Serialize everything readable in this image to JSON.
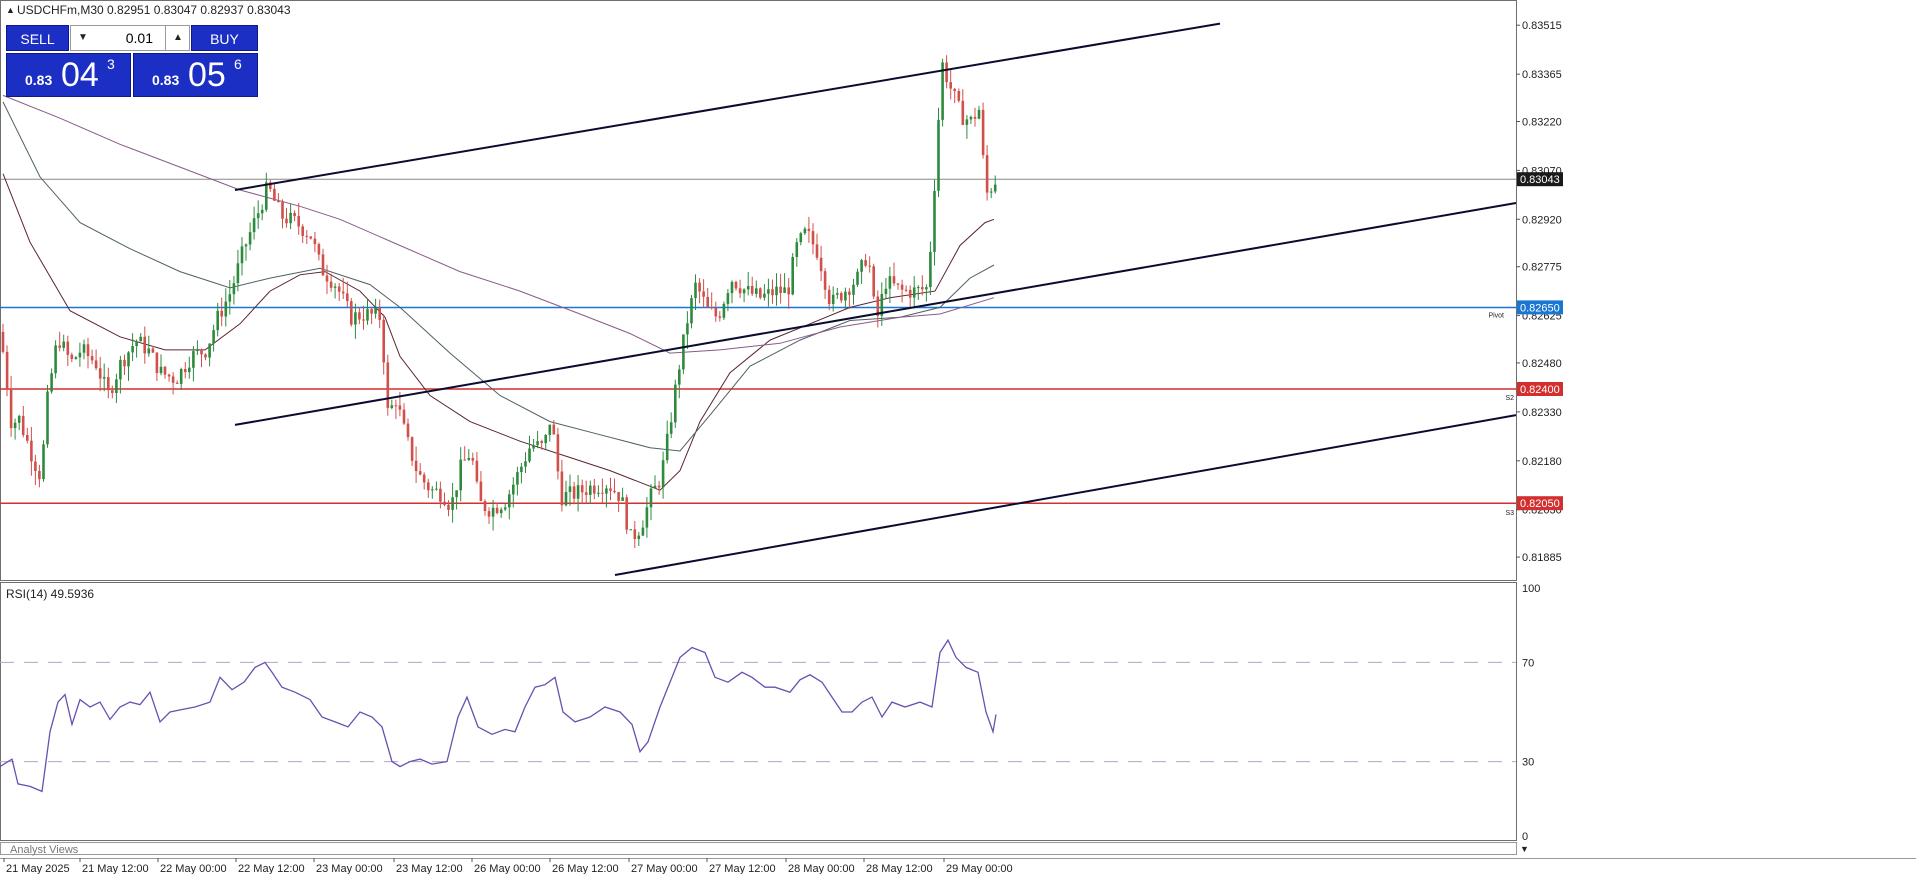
{
  "header": {
    "symbol_line": "USDCHFm,M30  0.82951 0.83047 0.82937 0.83043",
    "collapse_glyph": "▲"
  },
  "trade_panel": {
    "sell_label": "SELL",
    "buy_label": "BUY",
    "volume": "0.01",
    "sell_price": {
      "prefix": "0.83",
      "big": "04",
      "sup": "3"
    },
    "buy_price": {
      "prefix": "0.83",
      "big": "05",
      "sup": "6"
    },
    "down_glyph": "▼",
    "up_glyph": "▲"
  },
  "price_axis": {
    "ticks": [
      "0.83515",
      "0.83365",
      "0.83220",
      "0.83070",
      "0.82920",
      "0.82775",
      "0.82625",
      "0.82480",
      "0.82330",
      "0.82180",
      "0.82030",
      "0.81885"
    ],
    "current_price": "0.83043",
    "pivot_price": "0.82650",
    "s2_price": "0.82400",
    "s3_price": "0.82050"
  },
  "levels": {
    "pivot_label": "Pivot",
    "s2_label": "S2",
    "s3_label": "S3",
    "colors": {
      "pivot": "#1976d2",
      "support": "#d32f2f",
      "current": "#888888"
    }
  },
  "rsi": {
    "title": "RSI(14) 49.5936",
    "ticks": [
      "100",
      "70",
      "30",
      "0"
    ]
  },
  "time_axis": {
    "labels": [
      "21 May 2025",
      "21 May 12:00",
      "22 May 00:00",
      "22 May 12:00",
      "23 May 00:00",
      "23 May 12:00",
      "26 May 00:00",
      "26 May 12:00",
      "27 May 00:00",
      "27 May 12:00",
      "28 May 00:00",
      "28 May 12:00",
      "29 May 00:00"
    ]
  },
  "footer": {
    "analyst_tab": "Analyst Views",
    "scroll_glyph": "▼"
  },
  "colors": {
    "bull": "#2e8b3e",
    "bear": "#d1504b",
    "rsi_line": "#6a4fb0",
    "ma_fast": "#5a2430",
    "ma_mid": "#4f5f66",
    "ma_slow": "#8a5a8a",
    "channel": "#0b0b30",
    "axis_label_bg": "#1a1a1a"
  },
  "chart_data": {
    "type": "candlestick",
    "title": "USDCHFm,M30",
    "ylim": [
      0.8183,
      0.8358
    ],
    "pivot": 0.8265,
    "s2": 0.824,
    "s3": 0.8205,
    "current": 0.83043,
    "price_path": [
      [
        0,
        0.8262
      ],
      [
        8,
        0.825
      ],
      [
        16,
        0.8228
      ],
      [
        22,
        0.8232
      ],
      [
        30,
        0.8225
      ],
      [
        38,
        0.8218
      ],
      [
        45,
        0.8213
      ],
      [
        52,
        0.8238
      ],
      [
        62,
        0.8256
      ],
      [
        75,
        0.8248
      ],
      [
        85,
        0.8252
      ],
      [
        100,
        0.8248
      ],
      [
        112,
        0.8238
      ],
      [
        125,
        0.8248
      ],
      [
        140,
        0.8255
      ],
      [
        152,
        0.8252
      ],
      [
        165,
        0.8245
      ],
      [
        180,
        0.8243
      ],
      [
        195,
        0.825
      ],
      [
        210,
        0.8252
      ],
      [
        222,
        0.8262
      ],
      [
        235,
        0.827
      ],
      [
        248,
        0.8283
      ],
      [
        262,
        0.8294
      ],
      [
        272,
        0.8302
      ],
      [
        285,
        0.8293
      ],
      [
        300,
        0.8291
      ],
      [
        315,
        0.8287
      ],
      [
        325,
        0.8277
      ],
      [
        340,
        0.8272
      ],
      [
        355,
        0.8262
      ],
      [
        370,
        0.8263
      ],
      [
        385,
        0.8262
      ],
      [
        392,
        0.8232
      ],
      [
        400,
        0.8237
      ],
      [
        410,
        0.8225
      ],
      [
        422,
        0.8214
      ],
      [
        435,
        0.8209
      ],
      [
        447,
        0.8208
      ],
      [
        455,
        0.8204
      ],
      [
        465,
        0.8216
      ],
      [
        475,
        0.8221
      ],
      [
        483,
        0.8205
      ],
      [
        495,
        0.8203
      ],
      [
        510,
        0.8206
      ],
      [
        522,
        0.8214
      ],
      [
        535,
        0.8223
      ],
      [
        548,
        0.8222
      ],
      [
        555,
        0.8232
      ],
      [
        565,
        0.8207
      ],
      [
        580,
        0.8208
      ],
      [
        595,
        0.821
      ],
      [
        612,
        0.8211
      ],
      [
        625,
        0.8207
      ],
      [
        635,
        0.8194
      ],
      [
        645,
        0.8198
      ],
      [
        655,
        0.8207
      ],
      [
        665,
        0.8213
      ],
      [
        672,
        0.8225
      ],
      [
        682,
        0.8245
      ],
      [
        692,
        0.8262
      ],
      [
        700,
        0.8272
      ],
      [
        712,
        0.8264
      ],
      [
        722,
        0.8262
      ],
      [
        735,
        0.8274
      ],
      [
        750,
        0.827
      ],
      [
        765,
        0.8268
      ],
      [
        780,
        0.827
      ],
      [
        792,
        0.827
      ],
      [
        800,
        0.8283
      ],
      [
        810,
        0.8288
      ],
      [
        822,
        0.8282
      ],
      [
        835,
        0.8266
      ],
      [
        848,
        0.827
      ],
      [
        862,
        0.8274
      ],
      [
        872,
        0.8282
      ],
      [
        880,
        0.826
      ],
      [
        890,
        0.8273
      ],
      [
        905,
        0.827
      ],
      [
        920,
        0.827
      ],
      [
        932,
        0.8271
      ],
      [
        940,
        0.831
      ],
      [
        946,
        0.834
      ],
      [
        955,
        0.8332
      ],
      [
        965,
        0.8324
      ],
      [
        975,
        0.8322
      ],
      [
        983,
        0.8326
      ],
      [
        988,
        0.8307
      ],
      [
        993,
        0.8296
      ],
      [
        996,
        0.8304
      ]
    ],
    "moving_averages": {
      "fast": [
        [
          3,
          0.8306
        ],
        [
          30,
          0.8285
        ],
        [
          70,
          0.8264
        ],
        [
          120,
          0.8256
        ],
        [
          165,
          0.8252
        ],
        [
          205,
          0.8252
        ],
        [
          240,
          0.826
        ],
        [
          270,
          0.827
        ],
        [
          300,
          0.8275
        ],
        [
          325,
          0.8276
        ],
        [
          360,
          0.827
        ],
        [
          385,
          0.8262
        ],
        [
          400,
          0.825
        ],
        [
          430,
          0.8238
        ],
        [
          470,
          0.823
        ],
        [
          520,
          0.8224
        ],
        [
          570,
          0.8219
        ],
        [
          610,
          0.8215
        ],
        [
          660,
          0.8209
        ],
        [
          680,
          0.8215
        ],
        [
          700,
          0.823
        ],
        [
          730,
          0.8245
        ],
        [
          770,
          0.8255
        ],
        [
          810,
          0.826
        ],
        [
          850,
          0.8265
        ],
        [
          890,
          0.8268
        ],
        [
          935,
          0.827
        ],
        [
          960,
          0.8284
        ],
        [
          985,
          0.8291
        ],
        [
          994,
          0.8292
        ]
      ],
      "mid": [
        [
          3,
          0.8328
        ],
        [
          40,
          0.8305
        ],
        [
          80,
          0.8291
        ],
        [
          130,
          0.8283
        ],
        [
          180,
          0.8276
        ],
        [
          230,
          0.8271
        ],
        [
          270,
          0.8274
        ],
        [
          320,
          0.8277
        ],
        [
          370,
          0.8272
        ],
        [
          400,
          0.8265
        ],
        [
          450,
          0.8251
        ],
        [
          500,
          0.8238
        ],
        [
          550,
          0.823
        ],
        [
          600,
          0.8226
        ],
        [
          650,
          0.8222
        ],
        [
          680,
          0.8221
        ],
        [
          710,
          0.8232
        ],
        [
          750,
          0.8247
        ],
        [
          800,
          0.8255
        ],
        [
          850,
          0.8261
        ],
        [
          900,
          0.8262
        ],
        [
          940,
          0.8265
        ],
        [
          970,
          0.8274
        ],
        [
          994,
          0.8278
        ]
      ],
      "slow": [
        [
          3,
          0.833
        ],
        [
          60,
          0.8323
        ],
        [
          120,
          0.8315
        ],
        [
          180,
          0.8308
        ],
        [
          240,
          0.8301
        ],
        [
          300,
          0.8296
        ],
        [
          340,
          0.8292
        ],
        [
          400,
          0.8284
        ],
        [
          460,
          0.8276
        ],
        [
          520,
          0.827
        ],
        [
          580,
          0.8263
        ],
        [
          630,
          0.8257
        ],
        [
          670,
          0.8251
        ],
        [
          720,
          0.8252
        ],
        [
          780,
          0.8254
        ],
        [
          840,
          0.8259
        ],
        [
          900,
          0.8262
        ],
        [
          940,
          0.8263
        ],
        [
          994,
          0.8268
        ]
      ]
    },
    "channel_lines": [
      [
        [
          235,
          0.8301
        ],
        [
          1220,
          0.8352
        ]
      ],
      [
        [
          235,
          0.8229
        ],
        [
          1516,
          0.8297
        ]
      ],
      [
        [
          615,
          0.8183
        ],
        [
          1516,
          0.8232
        ]
      ]
    ],
    "rsi": {
      "name": "RSI(14)",
      "ylim": [
        0,
        100
      ],
      "levels": [
        70,
        30
      ],
      "path": [
        [
          0,
          28
        ],
        [
          12,
          31
        ],
        [
          18,
          21
        ],
        [
          30,
          20
        ],
        [
          42,
          18
        ],
        [
          50,
          42
        ],
        [
          58,
          54
        ],
        [
          65,
          57
        ],
        [
          72,
          45
        ],
        [
          80,
          55
        ],
        [
          90,
          52
        ],
        [
          100,
          54
        ],
        [
          110,
          47
        ],
        [
          120,
          52
        ],
        [
          130,
          54
        ],
        [
          140,
          53
        ],
        [
          150,
          58
        ],
        [
          160,
          46
        ],
        [
          170,
          50
        ],
        [
          182,
          51
        ],
        [
          195,
          52
        ],
        [
          210,
          54
        ],
        [
          220,
          64
        ],
        [
          232,
          59
        ],
        [
          244,
          62
        ],
        [
          255,
          68
        ],
        [
          265,
          70
        ],
        [
          272,
          66
        ],
        [
          282,
          60
        ],
        [
          295,
          58
        ],
        [
          310,
          55
        ],
        [
          322,
          48
        ],
        [
          335,
          46
        ],
        [
          348,
          44
        ],
        [
          360,
          50
        ],
        [
          372,
          48
        ],
        [
          382,
          44
        ],
        [
          392,
          30
        ],
        [
          400,
          28
        ],
        [
          410,
          30
        ],
        [
          420,
          31
        ],
        [
          432,
          29
        ],
        [
          447,
          30
        ],
        [
          458,
          48
        ],
        [
          467,
          56
        ],
        [
          478,
          44
        ],
        [
          492,
          41
        ],
        [
          505,
          43
        ],
        [
          515,
          42
        ],
        [
          525,
          52
        ],
        [
          535,
          60
        ],
        [
          545,
          61
        ],
        [
          555,
          64
        ],
        [
          563,
          50
        ],
        [
          575,
          46
        ],
        [
          590,
          48
        ],
        [
          605,
          52
        ],
        [
          620,
          50
        ],
        [
          632,
          45
        ],
        [
          640,
          34
        ],
        [
          648,
          38
        ],
        [
          660,
          52
        ],
        [
          670,
          62
        ],
        [
          680,
          72
        ],
        [
          692,
          76
        ],
        [
          705,
          74
        ],
        [
          715,
          64
        ],
        [
          728,
          62
        ],
        [
          742,
          66
        ],
        [
          752,
          64
        ],
        [
          765,
          60
        ],
        [
          775,
          60
        ],
        [
          790,
          58
        ],
        [
          800,
          63
        ],
        [
          810,
          65
        ],
        [
          822,
          62
        ],
        [
          832,
          56
        ],
        [
          842,
          50
        ],
        [
          852,
          50
        ],
        [
          862,
          54
        ],
        [
          872,
          56
        ],
        [
          882,
          48
        ],
        [
          892,
          54
        ],
        [
          905,
          52
        ],
        [
          920,
          54
        ],
        [
          932,
          52
        ],
        [
          940,
          74
        ],
        [
          948,
          79
        ],
        [
          956,
          72
        ],
        [
          966,
          68
        ],
        [
          978,
          66
        ],
        [
          986,
          50
        ],
        [
          993,
          42
        ],
        [
          996,
          49
        ]
      ]
    }
  }
}
